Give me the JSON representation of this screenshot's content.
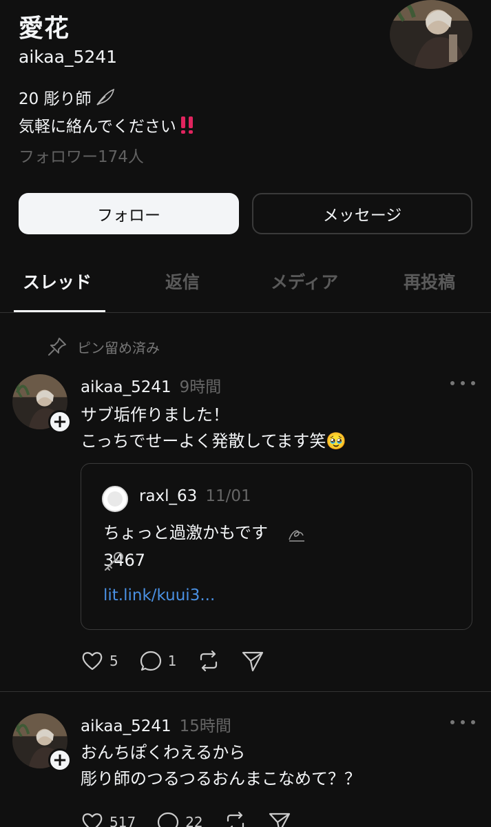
{
  "profile": {
    "name": "愛花",
    "handle": "aikaa_5241",
    "bio_line1": "20 彫り師",
    "bio_line2": "気軽に絡んでください",
    "followers": "フォロワー174人"
  },
  "buttons": {
    "follow": "フォロー",
    "message": "メッセージ"
  },
  "tabs": [
    {
      "label": "スレッド"
    },
    {
      "label": "返信"
    },
    {
      "label": "メディア"
    },
    {
      "label": "再投稿"
    }
  ],
  "pinned_label": "ピン留め済み",
  "posts": [
    {
      "user": "aikaa_5241",
      "time": "9時間",
      "text": "サブ垢作りました！\nこっちでせーよく発散してます笑🥹",
      "quote": {
        "user": "raxl_63",
        "date": "11/01",
        "text": "ちょっと過激かもです\n3467",
        "link": "lit.link/kuui3..."
      },
      "likes": "5",
      "replies": "1"
    },
    {
      "user": "aikaa_5241",
      "time": "15時間",
      "text": "おんちぽくわえるから\n彫り師のつるつるおんまこなめて？？",
      "likes": "517",
      "replies": "22"
    }
  ],
  "colors": {
    "background": "#101010",
    "text": "#f3f5f7",
    "muted": "#666666",
    "link": "#4a90e2",
    "alert": "#e0245e"
  }
}
